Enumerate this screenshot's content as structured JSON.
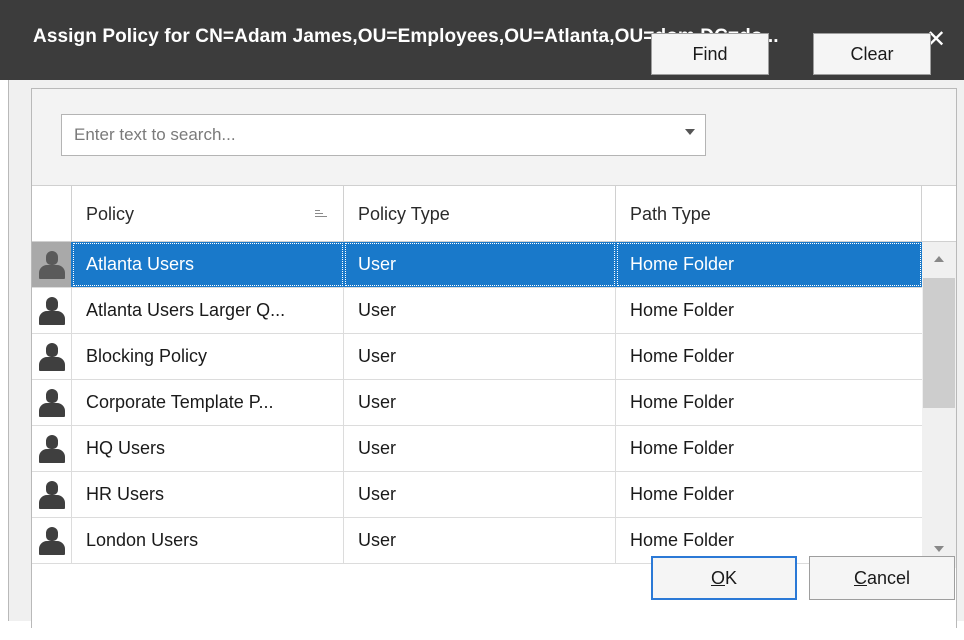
{
  "dialog": {
    "title": "Assign Policy for CN=Adam James,OU=Employees,OU=Atlanta,OU=dom,DC=do...",
    "close_glyph": "✕"
  },
  "search": {
    "placeholder": "Enter text to search...",
    "value": "",
    "find_label": "Find",
    "clear_label": "Clear"
  },
  "table": {
    "columns": [
      "Policy",
      "Policy Type",
      "Path Type"
    ],
    "sorted_column": "Policy",
    "rows": [
      {
        "policy": "Atlanta Users",
        "type": "User",
        "path": "Home Folder",
        "icon": "user-icon",
        "selected": true
      },
      {
        "policy": "Atlanta Users Larger Q...",
        "type": "User",
        "path": "Home Folder",
        "icon": "user-icon",
        "selected": false
      },
      {
        "policy": "Blocking Policy",
        "type": "User",
        "path": "Home Folder",
        "icon": "user-icon",
        "selected": false
      },
      {
        "policy": "Corporate Template P...",
        "type": "User",
        "path": "Home Folder",
        "icon": "user-icon",
        "selected": false
      },
      {
        "policy": "HQ Users",
        "type": "User",
        "path": "Home Folder",
        "icon": "user-icon",
        "selected": false
      },
      {
        "policy": "HR Users",
        "type": "User",
        "path": "Home Folder",
        "icon": "user-icon",
        "selected": false
      },
      {
        "policy": "London Users",
        "type": "User",
        "path": "Home Folder",
        "icon": "user-icon",
        "selected": false
      }
    ]
  },
  "footer": {
    "ok_label": "OK",
    "ok_mnemonic": "O",
    "ok_rest": "K",
    "cancel_label": "Cancel",
    "cancel_mnemonic": "C",
    "cancel_rest": "ancel"
  },
  "colors": {
    "titlebar": "#3c3c3c",
    "selection": "#1979ca",
    "default_button_border": "#2b79d6"
  }
}
